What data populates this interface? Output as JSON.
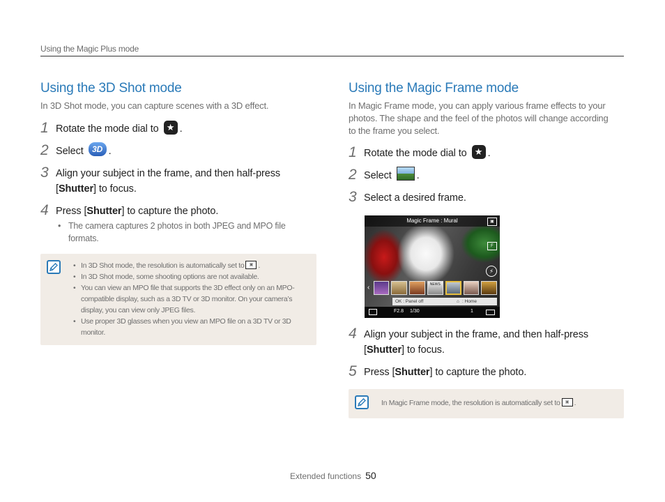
{
  "header": {
    "breadcrumb": "Using the Magic Plus mode"
  },
  "left": {
    "title": "Using the 3D Shot mode",
    "intro": "In 3D Shot mode, you can capture scenes with a 3D effect.",
    "steps": [
      {
        "num": "1",
        "pre": "Rotate the mode dial to",
        "post": "."
      },
      {
        "num": "2",
        "pre": "Select",
        "post": "."
      },
      {
        "num": "3",
        "line1": "Align your subject in the frame, and then half-press",
        "bracket_open": "[",
        "key": "Shutter",
        "rest": "] to focus."
      },
      {
        "num": "4",
        "pre": "Press [",
        "key": "Shutter",
        "post": "] to capture the photo."
      }
    ],
    "step4_bullet": "The camera captures 2 photos in both JPEG and MPO file formats.",
    "notes": {
      "n1_pre": "In 3D Shot mode, the resolution is automatically set to",
      "n1_post": ".",
      "n2": "In 3D Shot mode, some shooting options are not available.",
      "n3": "You can view an MPO file that supports the 3D effect only on an MPO-compatible display, such as a 3D TV or 3D monitor. On your camera’s display, you can view only JPEG files.",
      "n4": "Use proper 3D glasses when you view an MPO file on a 3D TV or 3D monitor."
    }
  },
  "right": {
    "title": "Using the Magic Frame mode",
    "intro": "In Magic Frame mode, you can apply various frame effects to your photos. The shape and the feel of the photos will change according to the frame you select.",
    "steps": [
      {
        "num": "1",
        "pre": "Rotate the mode dial to",
        "post": "."
      },
      {
        "num": "2",
        "pre": "Select",
        "post": "."
      },
      {
        "num": "3",
        "text": "Select a desired frame."
      },
      {
        "num": "4",
        "line1": "Align your subject in the frame, and then half-press",
        "bracket_open": "[",
        "key": "Shutter",
        "rest": "] to focus."
      },
      {
        "num": "5",
        "pre": "Press [",
        "key": "Shutter",
        "post": "] to capture the photo."
      }
    ],
    "screen": {
      "title": "Magic Frame : Mural",
      "hint_ok": "OK : Panel off",
      "hint_home": ": Home",
      "aperture": "F2.8",
      "shutter": "1/30",
      "count": "1",
      "thumb_label": "NEWS"
    },
    "note": {
      "pre": "In Magic Frame mode, the resolution is automatically set to",
      "post": "."
    }
  },
  "footer": {
    "label": "Extended functions",
    "page": "50"
  },
  "icons": {
    "mode_dial": "star-icon",
    "threed": "3d-mode-icon",
    "magic_frame": "magic-frame-icon",
    "note": "note-pencil-icon",
    "resolution": "resolution-icon"
  },
  "colors": {
    "accent": "#2a7ab8",
    "note_bg": "#f1ece6"
  }
}
